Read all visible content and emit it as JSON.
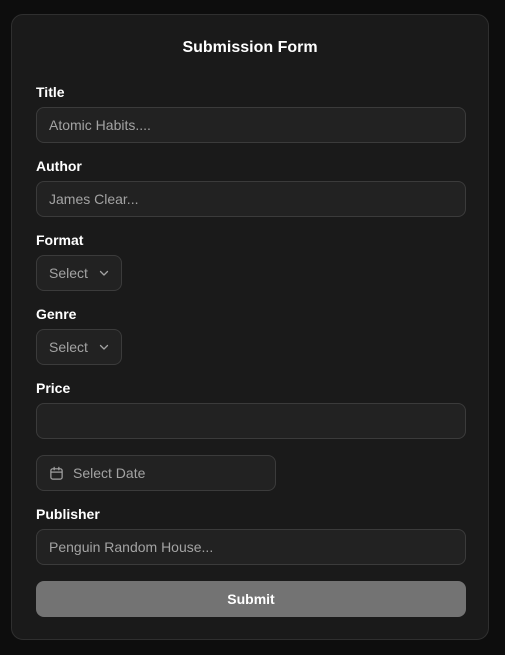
{
  "form": {
    "title": "Submission Form",
    "fields": {
      "title": {
        "label": "Title",
        "placeholder": "Atomic Habits....",
        "value": ""
      },
      "author": {
        "label": "Author",
        "placeholder": "James Clear...",
        "value": ""
      },
      "format": {
        "label": "Format",
        "selected": "Select"
      },
      "genre": {
        "label": "Genre",
        "selected": "Select"
      },
      "price": {
        "label": "Price",
        "placeholder": "",
        "value": ""
      },
      "date": {
        "placeholder": "Select Date",
        "icon": "calendar-icon"
      },
      "publisher": {
        "label": "Publisher",
        "placeholder": "Penguin Random House...",
        "value": ""
      }
    },
    "submit_label": "Submit"
  },
  "theme": {
    "background": "#0d0d0d",
    "card": "#1a1a1a",
    "input_bg": "#222222",
    "input_border": "#3b3b3b",
    "placeholder": "#a3a3a3",
    "button_bg": "#737373"
  }
}
